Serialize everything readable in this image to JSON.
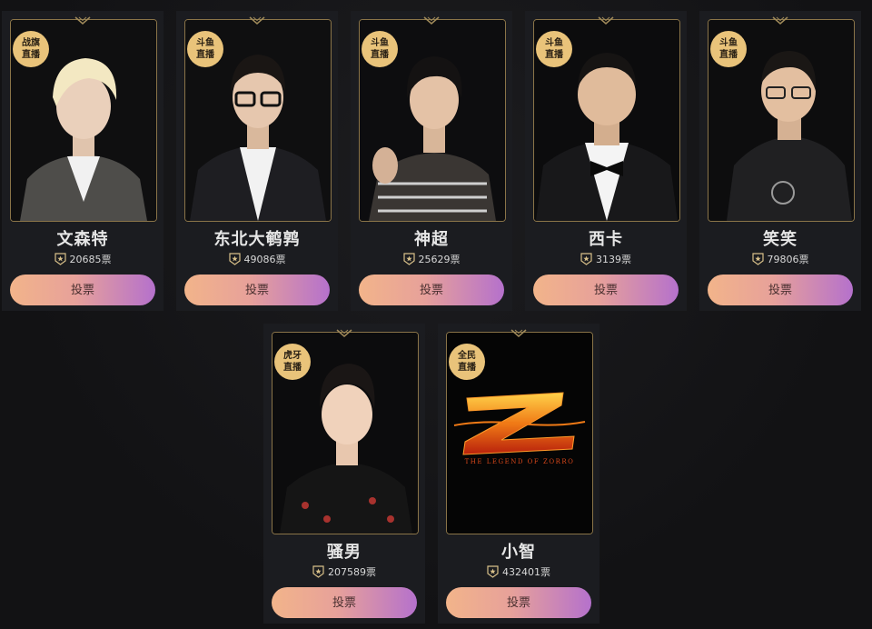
{
  "vote_label": "投票",
  "votes_suffix": "票",
  "cards": [
    {
      "platform_l1": "战旗",
      "platform_l2": "直播",
      "name": "文森特",
      "votes": "20685票"
    },
    {
      "platform_l1": "斗鱼",
      "platform_l2": "直播",
      "name": "东北大鹌鹑",
      "votes": "49086票"
    },
    {
      "platform_l1": "斗鱼",
      "platform_l2": "直播",
      "name": "神超",
      "votes": "25629票"
    },
    {
      "platform_l1": "斗鱼",
      "platform_l2": "直播",
      "name": "西卡",
      "votes": "3139票"
    },
    {
      "platform_l1": "斗鱼",
      "platform_l2": "直播",
      "name": "笑笑",
      "votes": "79806票"
    },
    {
      "platform_l1": "虎牙",
      "platform_l2": "直播",
      "name": "骚男",
      "votes": "207589票"
    },
    {
      "platform_l1": "全民",
      "platform_l2": "直播",
      "name": "小智",
      "votes": "432401票"
    }
  ],
  "zorro_caption": "THE LEGEND OF ZORRO",
  "colors": {
    "accent_gold": "#e9c37a",
    "frame_gold": "#8a7448",
    "button_start": "#f2b48a",
    "button_end": "#b571cc"
  },
  "icons": [
    "chevron-down-icon",
    "star-shield-icon"
  ]
}
